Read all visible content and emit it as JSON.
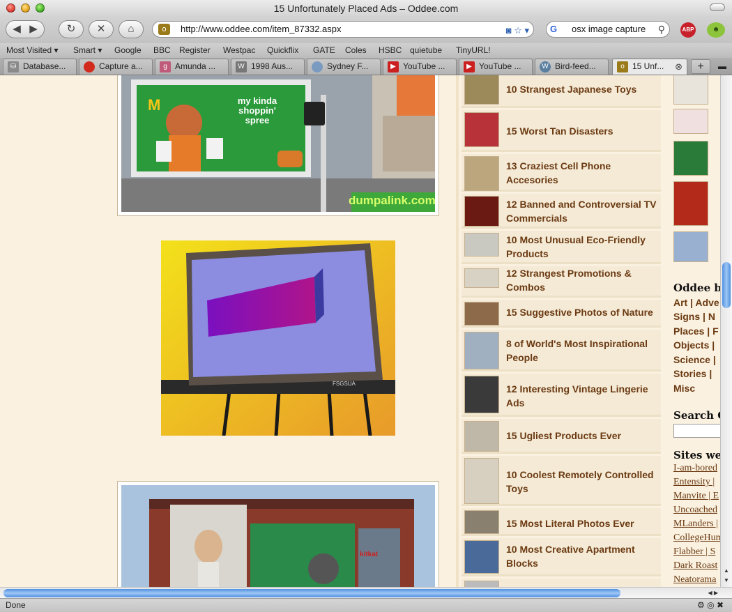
{
  "window": {
    "title": "15 Unfortunately Placed Ads – Oddee.com"
  },
  "toolbar": {
    "url": "http://www.oddee.com/item_87332.aspx",
    "search_value": "osx image capture",
    "abp_label": "ABP"
  },
  "bookmarks": [
    "Most Visited ▾",
    "Smart ▾",
    "Google",
    "BBC",
    "Register",
    "Westpac",
    "Quickflix",
    "GATE",
    "Coles",
    "HSBC",
    "quietube",
    "TinyURL!"
  ],
  "tabs": [
    {
      "label": "Database...",
      "icon": "database-icon",
      "color": "#8a8a8a"
    },
    {
      "label": "Capture a...",
      "icon": "red-dot-icon",
      "color": "#d32a1e"
    },
    {
      "label": "Amunda ...",
      "icon": "g-icon",
      "color": "#c05a7a"
    },
    {
      "label": "1998 Aus...",
      "icon": "wikipedia-icon",
      "color": "#777"
    },
    {
      "label": "Sydney F...",
      "icon": "globe-icon",
      "color": "#7a9ac0"
    },
    {
      "label": "YouTube ...",
      "icon": "youtube-icon",
      "color": "#cc2020"
    },
    {
      "label": "YouTube ...",
      "icon": "youtube-icon",
      "color": "#cc2020"
    },
    {
      "label": "Bird-feed...",
      "icon": "wordpress-icon",
      "color": "#5a7fa0"
    },
    {
      "label": "15 Unf...",
      "icon": "oddee-icon",
      "color": "#9b7a1a"
    }
  ],
  "ads": {
    "ad1_text": "my kinda shoppin' spree",
    "ad1_brand": "dumpalink.com",
    "ad2_brand": "FSGSUA",
    "ad3_sign": "kitkat"
  },
  "related": [
    {
      "title": "10 Strangest Japanese Toys",
      "color": "#9c8a5a"
    },
    {
      "title": "15 Worst Tan Disasters",
      "color": "#b8323a"
    },
    {
      "title": "13 Craziest Cell Phone Accesories",
      "color": "#bba67e"
    },
    {
      "title": "12 Banned and Controversial TV Commercials",
      "color": "#6a1a12"
    },
    {
      "title": "10 Most Unusual Eco-Friendly Products",
      "color": "#c9c9c2"
    },
    {
      "title": "12 Strangest Promotions & Combos",
      "color": "#d8d2c4"
    },
    {
      "title": "15 Suggestive Photos of Nature",
      "color": "#8c6a4a"
    },
    {
      "title": "8 of World's Most Inspirational People",
      "color": "#a0b0c0"
    },
    {
      "title": "12 Interesting Vintage Lingerie Ads",
      "color": "#3a3a3a"
    },
    {
      "title": "15 Ugliest Products Ever",
      "color": "#bfb7a8"
    },
    {
      "title": "10 Coolest Remotely Controlled Toys",
      "color": "#d7cfc0"
    },
    {
      "title": "15 Most Literal Photos Ever",
      "color": "#8a8070"
    },
    {
      "title": "10 Most Creative Apartment Blocks",
      "color": "#4a6a9a"
    }
  ],
  "sidebar": {
    "oddee_by": "Oddee by",
    "categories": [
      [
        "Art",
        "Adve"
      ],
      [
        "Signs",
        "N"
      ],
      [
        "Places",
        "F"
      ],
      [
        "Objects",
        ""
      ],
      [
        "Science",
        ""
      ],
      [
        "Stories",
        ""
      ],
      [
        "Misc"
      ]
    ],
    "search_label": "Search Od",
    "sites_label": "Sites we l",
    "sites": [
      "I-am-bored",
      "Entensity |",
      "Manvite | E",
      "Uncoached",
      "MLanders |",
      "CollegeHum",
      "Flabber | S",
      "Dark Roast",
      "Neatorama"
    ]
  },
  "status": {
    "text": "Done"
  }
}
